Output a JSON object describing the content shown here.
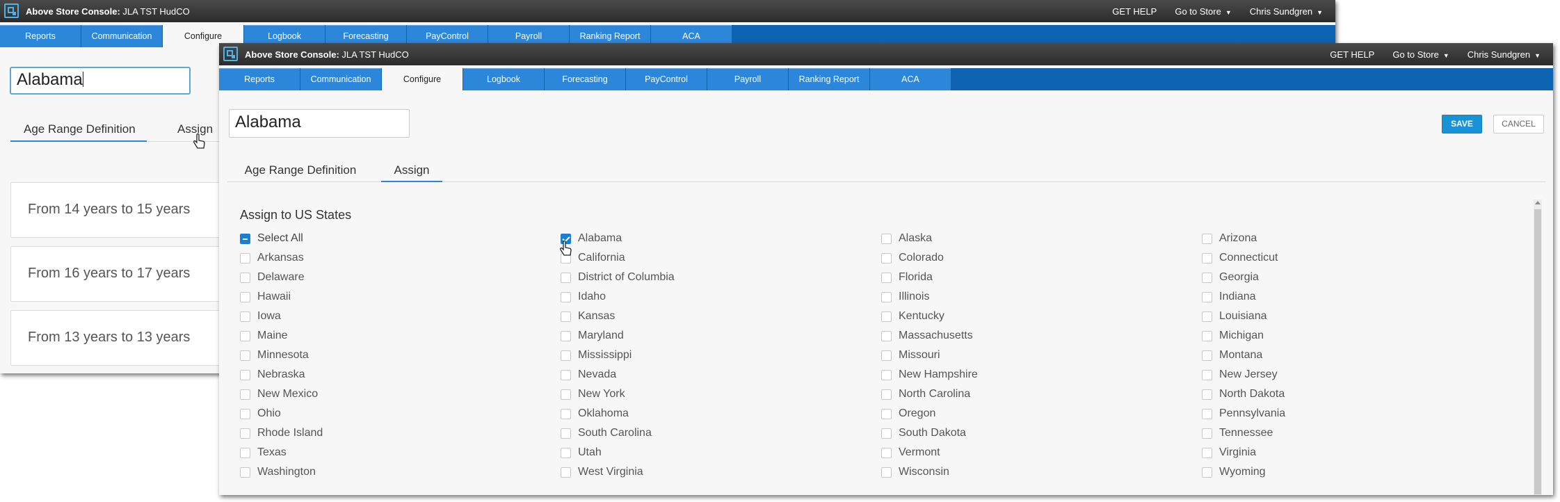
{
  "app": {
    "title_prefix": "Above Store Console:",
    "title_org": "JLA TST HudCO",
    "get_help": "GET HELP",
    "go_to_store": "Go to Store",
    "user": "Chris Sundgren"
  },
  "nav_tabs": [
    "Reports",
    "Communication",
    "Configure",
    "Logbook",
    "Forecasting",
    "PayControl",
    "Payroll",
    "Ranking Report",
    "ACA"
  ],
  "active_tab": "Configure",
  "name_value": "Alabama",
  "subtabs": {
    "age_range": "Age Range Definition",
    "assign": "Assign"
  },
  "age_ranges": [
    "From 14 years to 15 years",
    "From 16 years to 17 years",
    "From 13 years to 13 years"
  ],
  "buttons": {
    "save": "SAVE",
    "cancel": "CANCEL"
  },
  "assign_title": "Assign to US States",
  "select_all": {
    "label": "Select All",
    "state": "indeterminate"
  },
  "states": [
    {
      "name": "Alabama",
      "checked": true
    },
    {
      "name": "Alaska",
      "checked": false
    },
    {
      "name": "Arizona",
      "checked": false
    },
    {
      "name": "Arkansas",
      "checked": false
    },
    {
      "name": "California",
      "checked": false
    },
    {
      "name": "Colorado",
      "checked": false
    },
    {
      "name": "Connecticut",
      "checked": false
    },
    {
      "name": "Delaware",
      "checked": false
    },
    {
      "name": "District of Columbia",
      "checked": false
    },
    {
      "name": "Florida",
      "checked": false
    },
    {
      "name": "Georgia",
      "checked": false
    },
    {
      "name": "Hawaii",
      "checked": false
    },
    {
      "name": "Idaho",
      "checked": false
    },
    {
      "name": "Illinois",
      "checked": false
    },
    {
      "name": "Indiana",
      "checked": false
    },
    {
      "name": "Iowa",
      "checked": false
    },
    {
      "name": "Kansas",
      "checked": false
    },
    {
      "name": "Kentucky",
      "checked": false
    },
    {
      "name": "Louisiana",
      "checked": false
    },
    {
      "name": "Maine",
      "checked": false
    },
    {
      "name": "Maryland",
      "checked": false
    },
    {
      "name": "Massachusetts",
      "checked": false
    },
    {
      "name": "Michigan",
      "checked": false
    },
    {
      "name": "Minnesota",
      "checked": false
    },
    {
      "name": "Mississippi",
      "checked": false
    },
    {
      "name": "Missouri",
      "checked": false
    },
    {
      "name": "Montana",
      "checked": false
    },
    {
      "name": "Nebraska",
      "checked": false
    },
    {
      "name": "Nevada",
      "checked": false
    },
    {
      "name": "New Hampshire",
      "checked": false
    },
    {
      "name": "New Jersey",
      "checked": false
    },
    {
      "name": "New Mexico",
      "checked": false
    },
    {
      "name": "New York",
      "checked": false
    },
    {
      "name": "North Carolina",
      "checked": false
    },
    {
      "name": "North Dakota",
      "checked": false
    },
    {
      "name": "Ohio",
      "checked": false
    },
    {
      "name": "Oklahoma",
      "checked": false
    },
    {
      "name": "Oregon",
      "checked": false
    },
    {
      "name": "Pennsylvania",
      "checked": false
    },
    {
      "name": "Rhode Island",
      "checked": false
    },
    {
      "name": "South Carolina",
      "checked": false
    },
    {
      "name": "South Dakota",
      "checked": false
    },
    {
      "name": "Tennessee",
      "checked": false
    },
    {
      "name": "Texas",
      "checked": false
    },
    {
      "name": "Utah",
      "checked": false
    },
    {
      "name": "Vermont",
      "checked": false
    },
    {
      "name": "Virginia",
      "checked": false
    },
    {
      "name": "Washington",
      "checked": false
    },
    {
      "name": "West Virginia",
      "checked": false
    },
    {
      "name": "Wisconsin",
      "checked": false
    },
    {
      "name": "Wyoming",
      "checked": false
    }
  ],
  "colors": {
    "accent": "#1a7fd1",
    "nav_bar": "#0d63b0",
    "nav_tab": "#2c86d9",
    "title_bar": "#333333"
  }
}
